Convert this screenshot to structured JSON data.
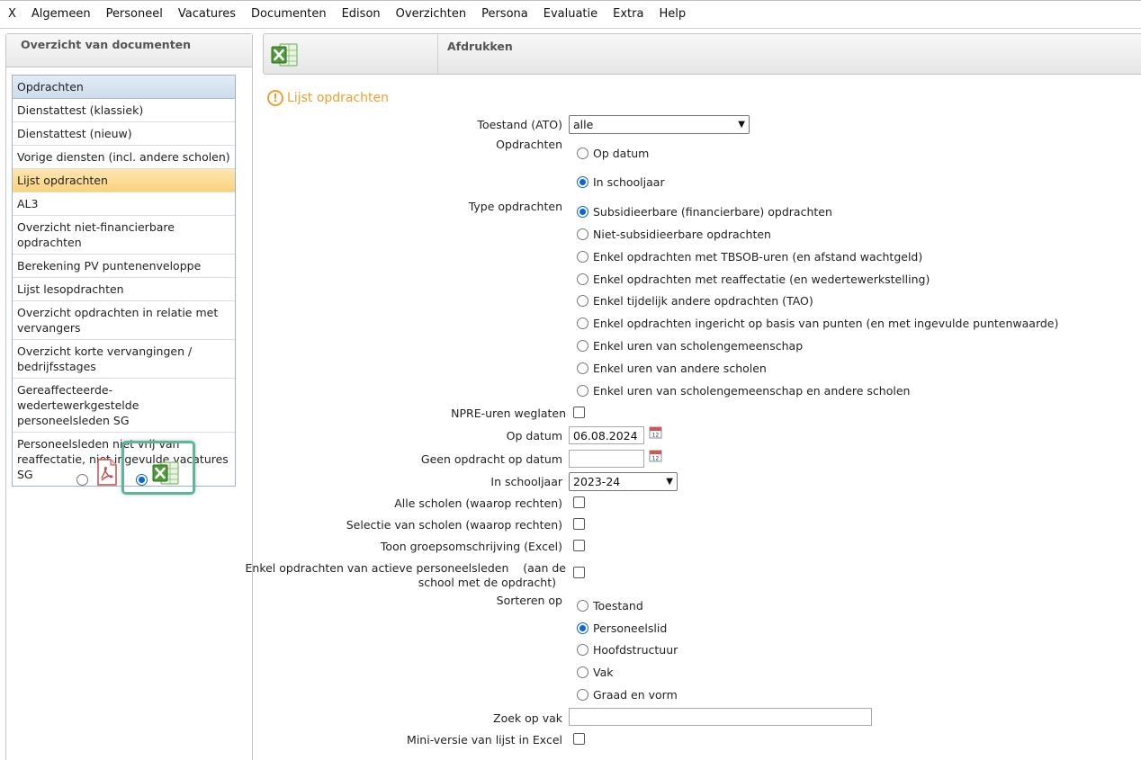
{
  "menu": [
    "X",
    "Algemeen",
    "Personeel",
    "Vacatures",
    "Documenten",
    "Edison",
    "Overzichten",
    "Persona",
    "Evaluatie",
    "Extra",
    "Help"
  ],
  "left_panel": {
    "title": "Overzicht van documenten",
    "items": [
      "Opdrachten",
      "Dienstattest (klassiek)",
      "Dienstattest (nieuw)",
      "Vorige diensten (incl. andere scholen)",
      "Lijst opdrachten",
      "AL3",
      "Overzicht niet-financierbare opdrachten",
      "Berekening PV puntenenveloppe",
      "Lijst lesopdrachten",
      "Overzicht opdrachten in relatie met vervangers",
      "Overzicht korte vervangingen / bedrijfsstages",
      "Gereaffecteerde-wedertewerkgestelde personeelsleden SG",
      "Personeelsleden niet vrij van reaffectatie, niet ingevulde vacatures SG"
    ],
    "active_index": 4,
    "format": {
      "pdf_icon": "pdf-icon",
      "excel_icon": "excel-icon",
      "selected": "excel"
    }
  },
  "right_header": {
    "icon": "excel-icon",
    "title": "Afdrukken"
  },
  "form": {
    "section_title": "Lijst opdrachten",
    "toestand_label": "Toestand (ATO)",
    "toestand_value": "alle",
    "opdrachten_label": "Opdrachten",
    "opdrachten_options": [
      "Op datum",
      "In schooljaar"
    ],
    "opdrachten_selected": 1,
    "type_label": "Type opdrachten",
    "type_options": [
      "Subsidieerbare (financierbare) opdrachten",
      "Niet-subsidieerbare opdrachten",
      "Enkel opdrachten met TBSOB-uren (en afstand wachtgeld)",
      "Enkel opdrachten met reaffectatie (en wedertewerkstelling)",
      "Enkel tijdelijk andere opdrachten (TAO)",
      "Enkel opdrachten ingericht op basis van punten (en met ingevulde puntenwaarde)",
      "Enkel uren van scholengemeenschap",
      "Enkel uren van andere scholen",
      "Enkel uren van scholengemeenschap en andere scholen"
    ],
    "type_selected": 0,
    "npre_label": "NPRE-uren weglaten",
    "op_datum_label": "Op datum",
    "op_datum_value": "06.08.2024",
    "geen_opdracht_label": "Geen opdracht op datum",
    "geen_opdracht_value": "",
    "schooljaar_label": "In schooljaar",
    "schooljaar_value": "2023-24",
    "alle_scholen_label": "Alle scholen (waarop rechten)",
    "selectie_scholen_label": "Selectie van scholen (waarop rechten)",
    "toon_groep_label": "Toon groepsomschrijving (Excel)",
    "enkel_actieve_label_1": "Enkel opdrachten van actieve personeelsleden    (aan de",
    "enkel_actieve_label_2": "school met de opdracht)",
    "sorteren_label": "Sorteren op",
    "sorteren_options": [
      "Toestand",
      "Personeelslid",
      "Hoofdstructuur",
      "Vak",
      "Graad en vorm"
    ],
    "sorteren_selected": 1,
    "zoek_label": "Zoek op vak",
    "zoek_value": "",
    "mini_label": "Mini-versie van lijst in Excel"
  }
}
